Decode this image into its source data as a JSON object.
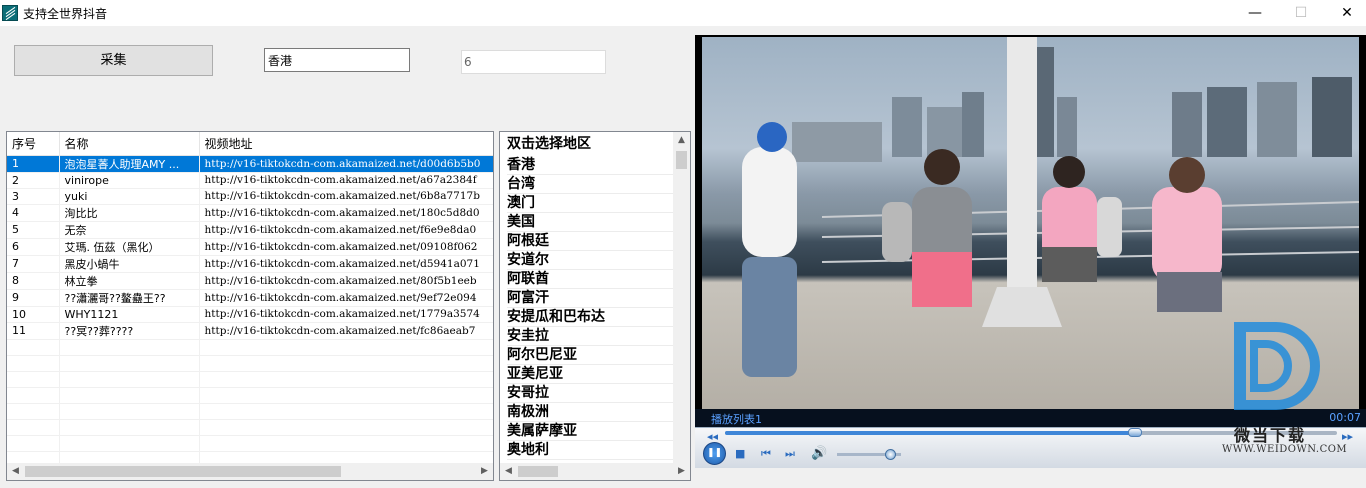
{
  "window": {
    "title": "支持全世界抖音",
    "minimize": "—",
    "maximize": "☐",
    "close": "✕"
  },
  "toolbar": {
    "collect_label": "采集",
    "region_value": "香港",
    "count_value": "6"
  },
  "grid": {
    "columns": [
      "序号",
      "名称",
      "视频地址"
    ],
    "rows": [
      {
        "no": "1",
        "name": "泡泡星萫人助理AMY ...",
        "url": "http://v16-tiktokcdn-com.akamaized.net/d00d6b5b0"
      },
      {
        "no": "2",
        "name": "vinirope",
        "url": "http://v16-tiktokcdn-com.akamaized.net/a67a2384f"
      },
      {
        "no": "3",
        "name": "yuki",
        "url": "http://v16-tiktokcdn-com.akamaized.net/6b8a7717b"
      },
      {
        "no": "4",
        "name": "洵比比",
        "url": "http://v16-tiktokcdn-com.akamaized.net/180c5d8d0"
      },
      {
        "no": "5",
        "name": "无奈",
        "url": "http://v16-tiktokcdn-com.akamaized.net/f6e9e8da0"
      },
      {
        "no": "6",
        "name": "艾瑪. 伍茲（黑化）",
        "url": "http://v16-tiktokcdn-com.akamaized.net/09108f062"
      },
      {
        "no": "7",
        "name": "黑皮小蝸牛",
        "url": "http://v16-tiktokcdn-com.akamaized.net/d5941a071"
      },
      {
        "no": "8",
        "name": "林立拳",
        "url": "http://v16-tiktokcdn-com.akamaized.net/80f5b1eeb"
      },
      {
        "no": "9",
        "name": "??瀟灑哥??鳌蠱王??",
        "url": "http://v16-tiktokcdn-com.akamaized.net/9ef72e094"
      },
      {
        "no": "10",
        "name": "WHY1121",
        "url": "http://v16-tiktokcdn-com.akamaized.net/1779a3574"
      },
      {
        "no": "11",
        "name": "??冥??葬????",
        "url": "http://v16-tiktokcdn-com.akamaized.net/fc86aeab7"
      }
    ],
    "selected_row": 0
  },
  "regions": {
    "header": "双击选择地区",
    "items": [
      "香港",
      "台湾",
      "澳门",
      "美国",
      "阿根廷",
      "安道尔",
      "阿联酋",
      "阿富汗",
      "安提瓜和巴布达",
      "安圭拉",
      "阿尔巴尼亚",
      "亚美尼亚",
      "安哥拉",
      "南极洲",
      "美属萨摩亚",
      "奥地利"
    ]
  },
  "player": {
    "playlist_label": "播放列表1",
    "time": "00:07",
    "seek_progress": 0.67,
    "volume_level": 0.85
  },
  "watermark": {
    "cn": "微当下载",
    "en": "WWW.WEIDOWN.COM"
  },
  "colors": {
    "selection": "#0078d7",
    "player_accent": "#2a6bbf"
  }
}
